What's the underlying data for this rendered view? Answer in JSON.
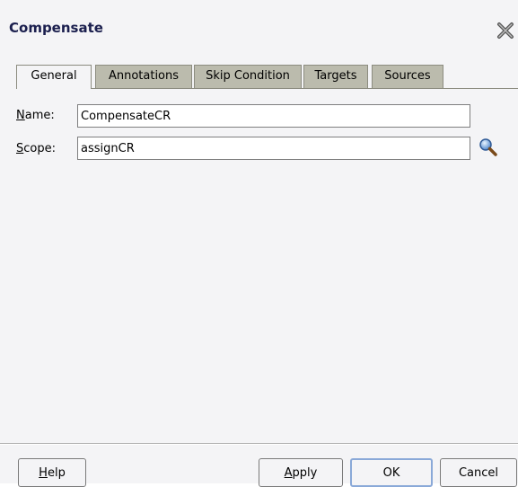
{
  "dialog": {
    "title": "Compensate"
  },
  "tabs": [
    {
      "label": "General",
      "active": true
    },
    {
      "label": "Annotations",
      "active": false
    },
    {
      "label": "Skip Condition",
      "active": false
    },
    {
      "label": "Targets",
      "active": false
    },
    {
      "label": "Sources",
      "active": false
    }
  ],
  "form": {
    "name": {
      "mnemonic": "N",
      "label_rest": "ame:",
      "value": "CompensateCR"
    },
    "scope": {
      "mnemonic": "S",
      "label_rest": "cope:",
      "value": "assignCR"
    }
  },
  "buttons": {
    "help": {
      "mnemonic": "H",
      "rest": "elp"
    },
    "apply": {
      "mnemonic": "A",
      "rest": "pply"
    },
    "ok": "OK",
    "cancel": "Cancel"
  },
  "colors": {
    "title": "#1b1f4e",
    "tab_inactive": "#bbbbad",
    "dialog_bg": "#f4f4f6"
  },
  "icons": {
    "close": "close-icon",
    "search": "search-icon"
  }
}
